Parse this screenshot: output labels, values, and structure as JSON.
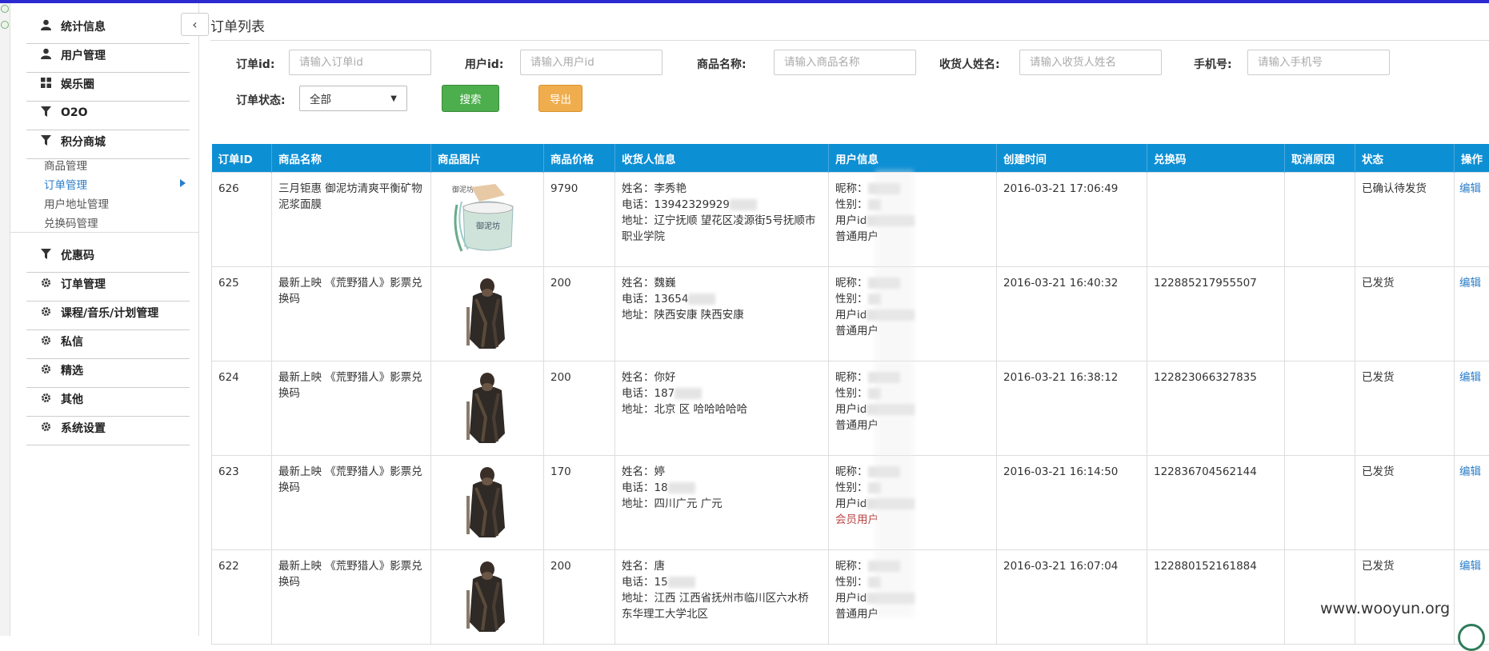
{
  "colors": {
    "header_blue": "#0d8fd4",
    "link_blue": "#2a7ec8",
    "search_green": "#4cae4c",
    "export_orange": "#f0ad4e"
  },
  "sidebar": {
    "items": [
      {
        "label": "统计信息",
        "icon": "user-icon"
      },
      {
        "label": "用户管理",
        "icon": "user-icon"
      },
      {
        "label": "娱乐圈",
        "icon": "grid-icon"
      },
      {
        "label": "O2O",
        "icon": "filter-icon"
      },
      {
        "label": "积分商城",
        "icon": "filter-icon"
      }
    ],
    "subitems": [
      {
        "label": "商品管理",
        "active": false
      },
      {
        "label": "订单管理",
        "active": true
      },
      {
        "label": "用户地址管理",
        "active": false
      },
      {
        "label": "兑换码管理",
        "active": false
      }
    ],
    "items2": [
      {
        "label": "优惠码",
        "icon": "filter-icon"
      },
      {
        "label": "订单管理",
        "icon": "gear-icon"
      },
      {
        "label": "课程/音乐/计划管理",
        "icon": "gear-icon"
      },
      {
        "label": "私信",
        "icon": "gear-icon"
      },
      {
        "label": "精选",
        "icon": "gear-icon"
      },
      {
        "label": "其他",
        "icon": "gear-icon"
      },
      {
        "label": "系统设置",
        "icon": "gear-icon"
      }
    ]
  },
  "page": {
    "title": "订单列表"
  },
  "filters": {
    "order_id": {
      "label": "订单id:",
      "placeholder": "请输入订单id"
    },
    "user_id": {
      "label": "用户id:",
      "placeholder": "请输入用户id"
    },
    "product_name": {
      "label": "商品名称:",
      "placeholder": "请输入商品名称"
    },
    "receiver_name": {
      "label": "收货人姓名:",
      "placeholder": "请输入收货人姓名"
    },
    "phone": {
      "label": "手机号:",
      "placeholder": "请输入手机号"
    },
    "status": {
      "label": "订单状态:",
      "value": "全部"
    },
    "search_label": "搜索",
    "export_label": "导出"
  },
  "table": {
    "headers": [
      "订单ID",
      "商品名称",
      "商品图片",
      "商品价格",
      "收货人信息",
      "用户信息",
      "创建时间",
      "兑换码",
      "取消原因",
      "状态",
      "操作"
    ],
    "rows": [
      {
        "id": "626",
        "product": "三月钜惠 御泥坊清爽平衡矿物泥浆面膜",
        "img": "jar",
        "price": "9790",
        "r_name": "姓名：李秀艳",
        "r_phone": "电话：13942329929",
        "r_addr": "地址：辽宁抚顺 望花区凌源街5号抚顺市职业学院",
        "u_nick": "昵称：",
        "u_sex": "性别：",
        "u_id": "用户id",
        "u_type": "普通用户",
        "member": false,
        "created": "2016-03-21 17:06:49",
        "code": "",
        "cancel": "",
        "status": "已确认待发货",
        "action": "编辑"
      },
      {
        "id": "625",
        "product": "最新上映 《荒野猎人》影票兑换码",
        "img": "hunter",
        "price": "200",
        "r_name": "姓名：魏巍",
        "r_phone": "电话：13654",
        "r_addr": "地址：陕西安康 陕西安康",
        "u_nick": "昵称：",
        "u_sex": "性别：",
        "u_id": "用户id",
        "u_type": "普通用户",
        "member": false,
        "created": "2016-03-21 16:40:32",
        "code": "122885217955507",
        "cancel": "",
        "status": "已发货",
        "action": "编辑"
      },
      {
        "id": "624",
        "product": "最新上映 《荒野猎人》影票兑换码",
        "img": "hunter",
        "price": "200",
        "r_name": "姓名：你好",
        "r_phone": "电话：187",
        "r_addr": "地址：北京 区 哈哈哈哈哈",
        "u_nick": "昵称：",
        "u_sex": "性别：",
        "u_id": "用户id",
        "u_type": "普通用户",
        "member": false,
        "created": "2016-03-21 16:38:12",
        "code": "122823066327835",
        "cancel": "",
        "status": "已发货",
        "action": "编辑"
      },
      {
        "id": "623",
        "product": "最新上映 《荒野猎人》影票兑换码",
        "img": "hunter",
        "price": "170",
        "r_name": "姓名：婷",
        "r_phone": "电话：18",
        "r_addr": "地址：四川广元 广元",
        "u_nick": "昵称：",
        "u_sex": "性别：",
        "u_id": "用户id",
        "u_type": "会员用户",
        "member": true,
        "created": "2016-03-21 16:14:50",
        "code": "122836704562144",
        "cancel": "",
        "status": "已发货",
        "action": "编辑"
      },
      {
        "id": "622",
        "product": "最新上映 《荒野猎人》影票兑换码",
        "img": "hunter",
        "price": "200",
        "r_name": "姓名：唐",
        "r_phone": "电话：15",
        "r_addr": "地址：江西 江西省抚州市临川区六水桥 东华理工大学北区",
        "u_nick": "昵称：",
        "u_sex": "性别：",
        "u_id": "用户id",
        "u_type": "普通用户",
        "member": false,
        "created": "2016-03-21 16:07:04",
        "code": "122880152161884",
        "cancel": "",
        "status": "已发货",
        "action": "编辑"
      }
    ]
  },
  "watermark": "www.wooyun.org"
}
